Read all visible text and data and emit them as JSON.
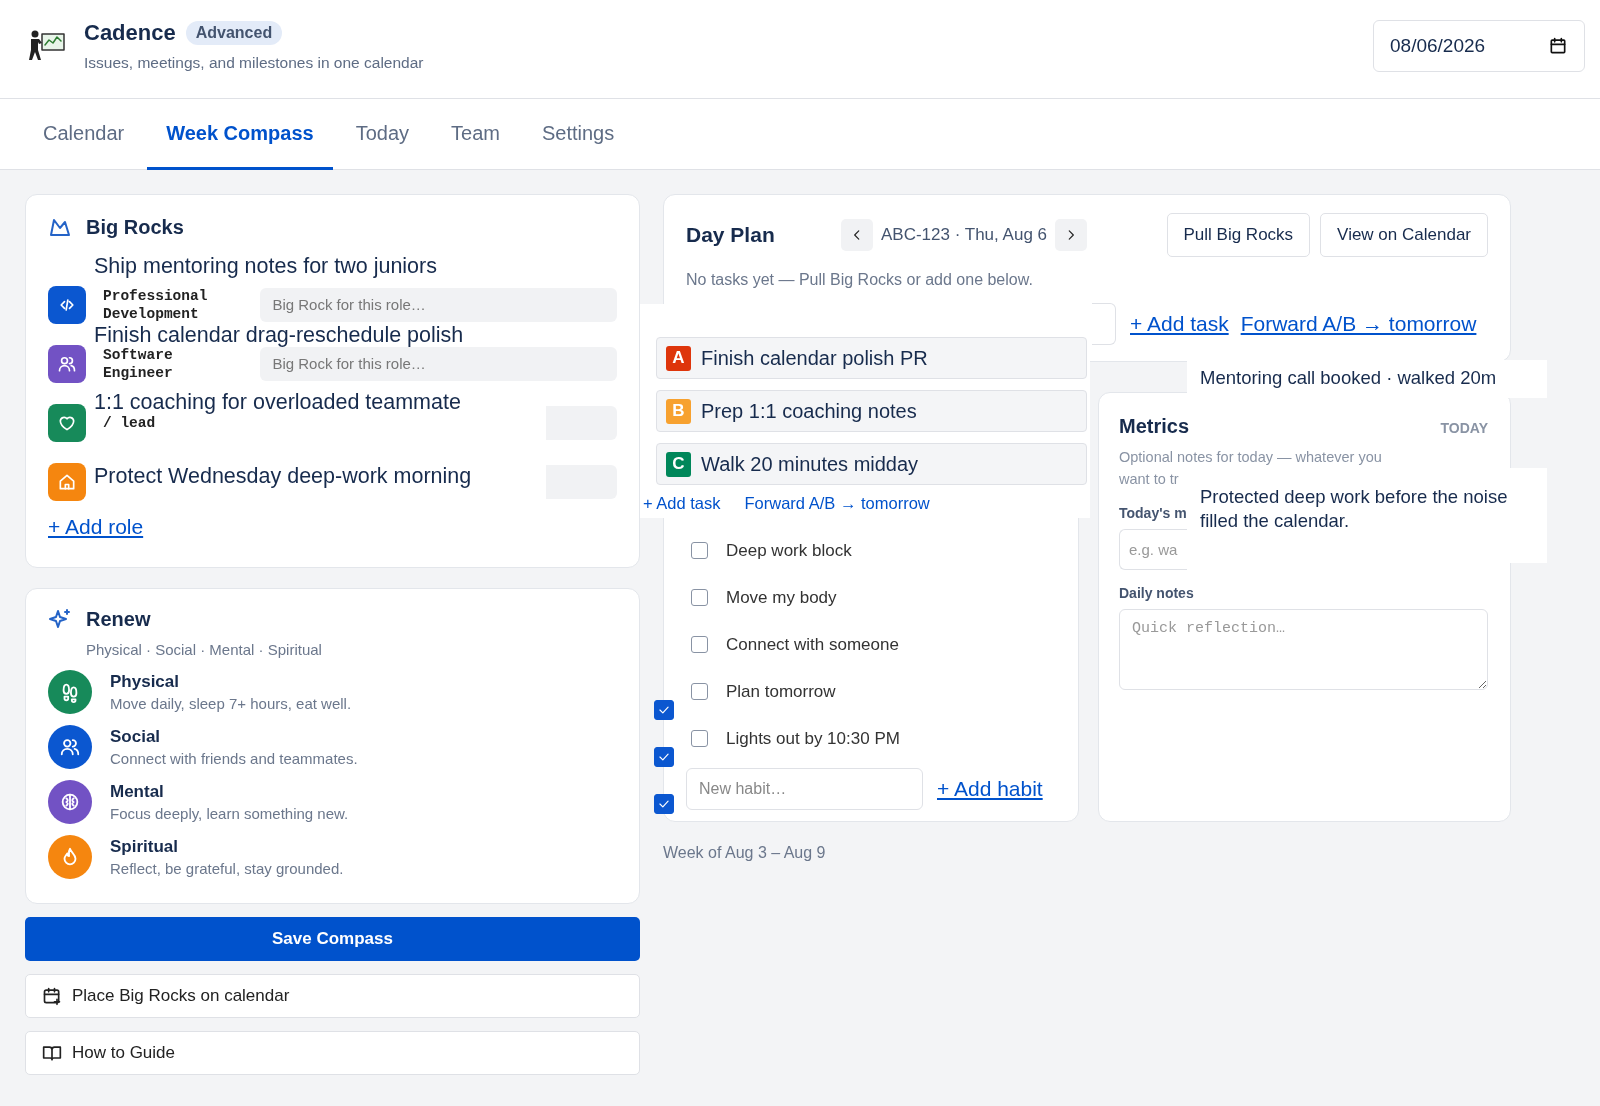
{
  "header": {
    "title": "Cadence",
    "badge": "Advanced",
    "subtitle": "Issues, meetings, and milestones in one calendar",
    "date": "08/06/2026"
  },
  "tabs": [
    {
      "label": "Calendar",
      "selected": false
    },
    {
      "label": "Week Compass",
      "selected": true
    },
    {
      "label": "Today",
      "selected": false
    },
    {
      "label": "Team",
      "selected": false
    },
    {
      "label": "Settings",
      "selected": false
    }
  ],
  "big_rocks": {
    "title": "Big Rocks",
    "roles": [
      {
        "label": "Professional Development",
        "placeholder": "Big Rock for this role…",
        "color": "#0b57d0"
      },
      {
        "label": "Software Engineer",
        "placeholder": "Big Rock for this role…",
        "color": "#7252c4"
      },
      {
        "label": "/ lead",
        "color": "#178a5a"
      },
      {
        "color": "#f5860f"
      }
    ],
    "add_link": "+ Add role"
  },
  "renew": {
    "title": "Renew",
    "subtitle": "Physical · Social · Mental · Spiritual",
    "items": [
      {
        "name": "Physical",
        "desc": "Move daily, sleep 7+ hours, eat well.",
        "color": "#178a5a"
      },
      {
        "name": "Social",
        "desc": "Connect with friends and teammates.",
        "color": "#0b57d0"
      },
      {
        "name": "Mental",
        "desc": "Focus deeply, learn something new.",
        "color": "#7252c4"
      },
      {
        "name": "Spiritual",
        "desc": "Reflect, be grateful, stay grounded.",
        "color": "#f5860f"
      }
    ]
  },
  "actions": [
    {
      "label": "Save Compass",
      "kind": "primary"
    },
    {
      "label": "Place Big Rocks on calendar",
      "kind": "calendar"
    },
    {
      "label": "How to Guide",
      "kind": "guide"
    }
  ],
  "day_plan": {
    "title": "Day Plan",
    "day_label": "ABC-123 · Thu, Aug 6",
    "buttons": [
      "Pull Big Rocks",
      "View on Calendar"
    ],
    "empty_text": "No tasks yet — Pull Big Rocks or add one below.",
    "links": [
      "+ Add task",
      "Forward A/B → tomorrow"
    ]
  },
  "habits": {
    "items": [
      {
        "label": "Deep work block",
        "checked": false
      },
      {
        "label": "Move my body",
        "checked": false
      },
      {
        "label": "Connect with someone",
        "checked": false
      },
      {
        "label": "Plan tomorrow",
        "checked": false
      },
      {
        "label": "Lights out by 10:30 PM",
        "checked": false
      }
    ],
    "placeholder": "New habit…",
    "add_link": "+ Add habit"
  },
  "week_label": "Week of Aug 3 – Aug 9",
  "metrics": {
    "title": "Metrics",
    "badge": "TODAY",
    "subtitle": "Optional notes for today — whatever you want to tr",
    "field_label": "Today's m",
    "field_placeholder": "e.g. wa",
    "notes_label": "Daily notes",
    "notes_placeholder": "Quick reflection…"
  },
  "pasted": {
    "big_rock_lines": [
      "Ship mentoring notes for two juniors",
      "Finish calendar drag-reschedule polish",
      "1:1 coaching for overloaded teammate",
      "Protect Wednesday deep-work morning"
    ],
    "tasks": [
      {
        "letter": "A",
        "title": "Finish calendar polish PR",
        "color": "#de350b"
      },
      {
        "letter": "B",
        "title": "Prep 1:1 coaching notes",
        "color": "#f7a12f"
      },
      {
        "letter": "C",
        "title": "Walk 20 minutes midday",
        "color": "#00875a"
      }
    ],
    "task_links": [
      "+ Add task",
      "Forward A/B → tomorrow"
    ],
    "checkmarks": [
      {
        "checked": true
      },
      {
        "checked": true
      },
      {
        "checked": true
      }
    ],
    "notes": [
      "Mentoring call booked · walked 20m",
      "Protected deep work before the noise filled the calendar."
    ]
  }
}
